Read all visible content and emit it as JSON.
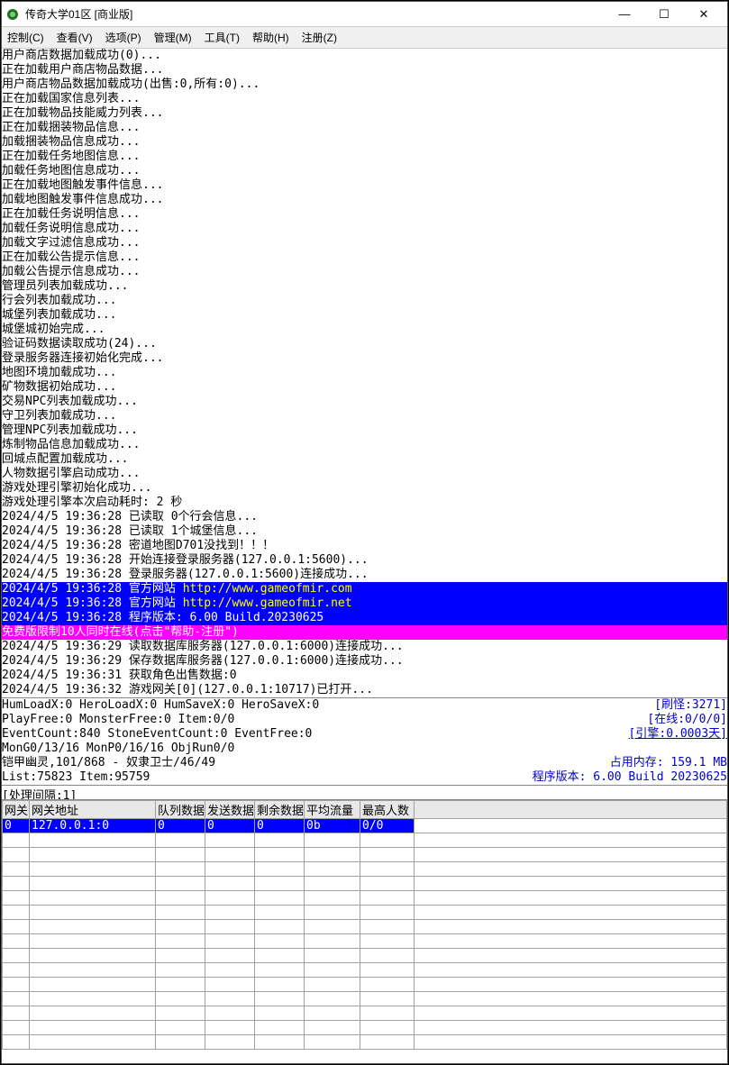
{
  "window": {
    "title": "传奇大学01区  [商业版]"
  },
  "menu": {
    "control": "控制(C)",
    "view": "查看(V)",
    "options": "选项(P)",
    "manage": "管理(M)",
    "tools": "工具(T)",
    "help": "帮助(H)",
    "register": "注册(Z)"
  },
  "log": [
    "用户商店数据加载成功(0)...",
    "正在加载用户商店物品数据...",
    "用户商店物品数据加载成功(出售:0,所有:0)...",
    "正在加载国家信息列表...",
    "正在加载物品技能威力列表...",
    "正在加载捆装物品信息...",
    "加载捆装物品信息成功...",
    "正在加载任务地图信息...",
    "加载任务地图信息成功...",
    "正在加载地图触发事件信息...",
    "加载地图触发事件信息成功...",
    "正在加载任务说明信息...",
    "加载任务说明信息成功...",
    "加载文字过滤信息成功...",
    "正在加载公告提示信息...",
    "加载公告提示信息成功...",
    "管理员列表加载成功...",
    "行会列表加载成功...",
    "城堡列表加载成功...",
    "城堡城初始完成...",
    "验证码数据读取成功(24)...",
    "登录服务器连接初始化完成...",
    "地图环境加载成功...",
    "矿物数据初始成功...",
    "交易NPC列表加载成功...",
    "守卫列表加载成功...",
    "管理NPC列表加载成功...",
    "炼制物品信息加载成功...",
    "回城点配置加载成功...",
    "人物数据引擎启动成功...",
    "游戏处理引擎初始化成功...",
    "游戏处理引擎本次启动耗时: 2 秒",
    "2024/4/5 19:36:28 已读取 0个行会信息...",
    "2024/4/5 19:36:28 已读取 1个城堡信息...",
    "2024/4/5 19:36:28 密道地图D701没找到！！！",
    "2024/4/5 19:36:28 开始连接登录服务器(127.0.0.1:5600)...",
    "2024/4/5 19:36:28 登录服务器(127.0.0.1:5600)连接成功..."
  ],
  "hl1": {
    "ts": "2024/4/5 19:36:28 ",
    "label": "官方网站 ",
    "url": "http://www.gameofmir.com"
  },
  "hl2": {
    "ts": "2024/4/5 19:36:28 ",
    "label": "官方网站 ",
    "url": "http://www.gameofmir.net"
  },
  "hl3": {
    "ts": "2024/4/5 19:36:28 ",
    "label": "程序版本: 6.00 Build.20230625"
  },
  "hl4": "免费版限制10人同时在线(点击\"帮助-注册\")",
  "log2": [
    "2024/4/5 19:36:29 读取数据库服务器(127.0.0.1:6000)连接成功...",
    "2024/4/5 19:36:29 保存数据库服务器(127.0.0.1:6000)连接成功...",
    "2024/4/5 19:36:31 获取角色出售数据:0",
    "2024/4/5 19:36:32 游戏网关[0](127.0.0.1:10717)已打开..."
  ],
  "stats": {
    "l1l": "HumLoadX:0 HeroLoadX:0 HumSaveX:0 HeroSaveX:0",
    "l1r": "[刷怪:3271]",
    "l2l": "PlayFree:0 MonsterFree:0 Item:0/0",
    "l2r": "[在线:0/0/0]",
    "l3l": "EventCount:840 StoneEventCount:0 EventFree:0",
    "l3r": "[引擎:0.0003天]",
    "l4l": "MonG0/13/16 MonP0/16/16 ObjRun0/0",
    "l5l": "铠甲幽灵,101/868 - 奴隶卫士/46/49",
    "l5r": "占用内存:  159.1 MB",
    "l6l": "List:75823 Item:95759",
    "l6r": "程序版本: 6.00 Build 20230625",
    "procl": "[处理间隔:1]",
    "procr": ""
  },
  "table": {
    "headers": [
      "网关",
      "网关地址",
      "队列数据",
      "发送数据",
      "剩余数据",
      "平均流量",
      "最高人数"
    ],
    "row": [
      "0",
      "127.0.0.1:0",
      "0",
      "0",
      "0",
      "0b",
      "0/0"
    ]
  }
}
